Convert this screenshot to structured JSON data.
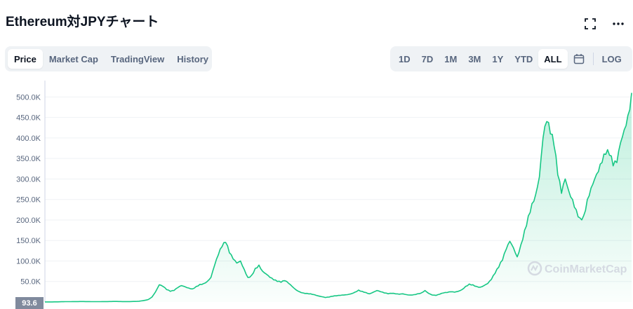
{
  "header": {
    "title": "Ethereum対JPYチャート",
    "fullscreen_icon": "fullscreen-icon",
    "more_icon": "more-icon"
  },
  "tabs": [
    {
      "label": "Price",
      "active": true
    },
    {
      "label": "Market Cap",
      "active": false
    },
    {
      "label": "TradingView",
      "active": false
    },
    {
      "label": "History",
      "active": false
    }
  ],
  "ranges": [
    {
      "label": "1D",
      "active": false
    },
    {
      "label": "7D",
      "active": false
    },
    {
      "label": "1M",
      "active": false
    },
    {
      "label": "3M",
      "active": false
    },
    {
      "label": "1Y",
      "active": false
    },
    {
      "label": "YTD",
      "active": false
    },
    {
      "label": "ALL",
      "active": true
    }
  ],
  "calendar_icon": "calendar-icon",
  "log_label": "LOG",
  "watermark": "CoinMarketCap",
  "current_marker": "93.6",
  "colors": {
    "line": "#16c784",
    "fill_top": "#16c784",
    "grid": "#eff2f5",
    "marker_bg": "#808a9d"
  },
  "chart_data": {
    "type": "area",
    "title": "Ethereum対JPYチャート",
    "xlabel": "",
    "ylabel": "",
    "ylim": [
      0,
      540000
    ],
    "y_ticks": [
      {
        "value": 50000,
        "label": "50.0K"
      },
      {
        "value": 100000,
        "label": "100.0K"
      },
      {
        "value": 150000,
        "label": "150.0K"
      },
      {
        "value": 200000,
        "label": "200.0K"
      },
      {
        "value": 250000,
        "label": "250.0K"
      },
      {
        "value": 300000,
        "label": "300.0K"
      },
      {
        "value": 350000,
        "label": "350.0K"
      },
      {
        "value": 400000,
        "label": "400.0K"
      },
      {
        "value": 450000,
        "label": "450.0K"
      },
      {
        "value": 500000,
        "label": "500.0K"
      }
    ],
    "grid": true,
    "series": [
      {
        "values": [
          94,
          120,
          200,
          300,
          500,
          700,
          800,
          900,
          1000,
          1100,
          1200,
          1100,
          1000,
          900,
          800,
          900,
          1000,
          1100,
          1200,
          1300,
          1200,
          1100,
          1000,
          1100,
          1300,
          1500,
          2500,
          4000,
          6000,
          12000,
          25000,
          42000,
          38000,
          30000,
          26000,
          28000,
          35000,
          40000,
          37000,
          34000,
          32000,
          38000,
          43000,
          45000,
          50000,
          60000,
          90000,
          115000,
          135000,
          145000,
          120000,
          105000,
          95000,
          100000,
          80000,
          60000,
          65000,
          82000,
          90000,
          75000,
          68000,
          60000,
          54000,
          50000,
          48000,
          52000,
          46000,
          38000,
          30000,
          25000,
          22000,
          21000,
          20000,
          18000,
          15000,
          13000,
          11000,
          12000,
          14000,
          15000,
          16000,
          17000,
          18000,
          20000,
          24000,
          29000,
          26000,
          23000,
          20000,
          24000,
          28000,
          25000,
          22000,
          20000,
          21000,
          20000,
          19000,
          20000,
          18000,
          17000,
          18000,
          20000,
          22000,
          28000,
          21000,
          17000,
          16000,
          19000,
          22000,
          23000,
          25000,
          24000,
          26000,
          30000,
          38000,
          44000,
          42000,
          38000,
          36000,
          40000,
          45000,
          55000,
          70000,
          85000,
          102000,
          128000,
          148000,
          132000,
          110000,
          140000,
          175000,
          210000,
          240000,
          262000,
          305000,
          400000,
          440000,
          410000,
          380000,
          310000,
          265000,
          300000,
          270000,
          250000,
          225000,
          205000,
          210000,
          250000,
          278000,
          300000,
          318000,
          340000,
          360000,
          358000,
          332000,
          340000,
          388000,
          420000,
          455000,
          510000
        ]
      }
    ]
  }
}
